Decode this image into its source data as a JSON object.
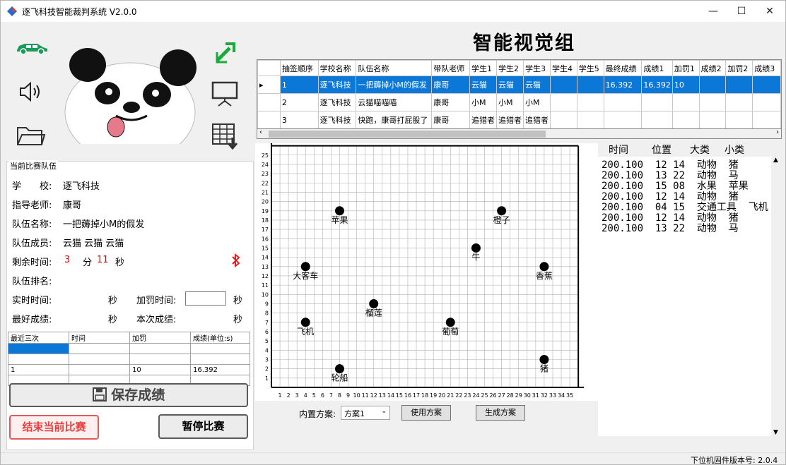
{
  "window": {
    "title": "逐飞科技智能裁判系统 V2.0.0",
    "minimize": "—",
    "maximize": "☐",
    "close": "✕"
  },
  "main_title": "智能视觉组",
  "team_panel": {
    "group_title": "当前比赛队伍",
    "school_label": "学　　校:",
    "school": "逐飞科技",
    "teacher_label": "指导老师:",
    "teacher": "康哥",
    "team_label": "队伍名称:",
    "team": "一把薅掉小M的假发",
    "members_label": "队伍成员:",
    "members": "云猫 云猫 云猫",
    "remaining_label": "剩余时间:",
    "remaining_min": "3",
    "min_unit": "分",
    "remaining_sec": "11",
    "sec_unit": "秒",
    "rank_label": "队伍排名:",
    "realtime_label": "实时时间:",
    "realtime_unit": "秒",
    "penalty_label": "加罚时间:",
    "penalty_unit": "秒",
    "penalty_value": "",
    "best_label": "最好成绩:",
    "best_unit": "秒",
    "current_label": "本次成绩:",
    "current_unit": "秒"
  },
  "recent_table": {
    "headers": [
      "最近三次",
      "时间",
      "加罚",
      "成绩(单位:s)"
    ],
    "rows": [
      [
        "",
        "",
        "",
        ""
      ],
      [
        "",
        "",
        "",
        ""
      ],
      [
        "1",
        "",
        "10",
        "16.392"
      ],
      [
        "",
        "",
        "",
        ""
      ]
    ]
  },
  "buttons": {
    "save": "保存成绩",
    "end": "结束当前比赛",
    "pause": "暂停比赛",
    "use_plan": "使用方案",
    "gen_plan": "生成方案"
  },
  "plan": {
    "label": "内置方案:",
    "selected": "方案1"
  },
  "grid": {
    "headers": [
      "",
      "抽签顺序",
      "学校名称",
      "队伍名称",
      "带队老师",
      "学生1",
      "学生2",
      "学生3",
      "学生4",
      "学生5",
      "最终成绩",
      "成绩1",
      "加罚1",
      "成绩2",
      "加罚2",
      "成绩3"
    ],
    "rows": [
      [
        "▸",
        "1",
        "逐飞科技",
        "一把薅掉小M的假发",
        "康哥",
        "云猫",
        "云猫",
        "云猫",
        "",
        "",
        "16.392",
        "16.392",
        "10",
        "",
        "",
        ""
      ],
      [
        "",
        "2",
        "逐飞科技",
        "云猫喵喵喵",
        "康哥",
        "小M",
        "小M",
        "小M",
        "",
        "",
        "",
        "",
        "",
        "",
        "",
        ""
      ],
      [
        "",
        "3",
        "逐飞科技",
        "快跑，康哥打屁股了",
        "康哥",
        "追猎者",
        "追猎者",
        "追猎者",
        "",
        "",
        "",
        "",
        "",
        "",
        "",
        ""
      ]
    ]
  },
  "log": {
    "headers": [
      "时间",
      "位置",
      "大类",
      "小类"
    ],
    "lines": [
      "200.100  12 14  动物  猪",
      "200.100  13 22  动物  马",
      "200.100  15 08  水果  苹果",
      "200.100  12 14  动物  猪",
      "200.100  04 15  交通工具  飞机",
      "200.100  12 14  动物  猪",
      "200.100  13 22  动物  马"
    ]
  },
  "map": {
    "x_ticks": [
      "1",
      "2",
      "3",
      "4",
      "5",
      "6",
      "7",
      "8",
      "9",
      "10",
      "11",
      "12",
      "13",
      "14",
      "15",
      "16",
      "17",
      "18",
      "19",
      "20",
      "21",
      "22",
      "23",
      "24",
      "25",
      "26",
      "27",
      "28",
      "29",
      "30",
      "31",
      "32",
      "33",
      "34",
      "35"
    ],
    "y_ticks": [
      "1",
      "2",
      "3",
      "4",
      "5",
      "6",
      "7",
      "8",
      "9",
      "10",
      "11",
      "12",
      "13",
      "14",
      "15",
      "16",
      "17",
      "18",
      "19",
      "20",
      "21",
      "22",
      "23",
      "24",
      "25"
    ],
    "points": [
      {
        "x": 8,
        "y": 19,
        "label": "苹果"
      },
      {
        "x": 27,
        "y": 19,
        "label": "橙子"
      },
      {
        "x": 24,
        "y": 15,
        "label": "牛"
      },
      {
        "x": 4,
        "y": 13,
        "label": "大客车"
      },
      {
        "x": 32,
        "y": 13,
        "label": "香蕉"
      },
      {
        "x": 12,
        "y": 9,
        "label": "榴莲"
      },
      {
        "x": 4,
        "y": 7,
        "label": "飞机"
      },
      {
        "x": 21,
        "y": 7,
        "label": "葡萄"
      },
      {
        "x": 32,
        "y": 3,
        "label": "猪"
      },
      {
        "x": 8,
        "y": 2,
        "label": "轮船"
      }
    ]
  },
  "status": {
    "firmware": "下位机固件版本号: 2.0.4"
  }
}
